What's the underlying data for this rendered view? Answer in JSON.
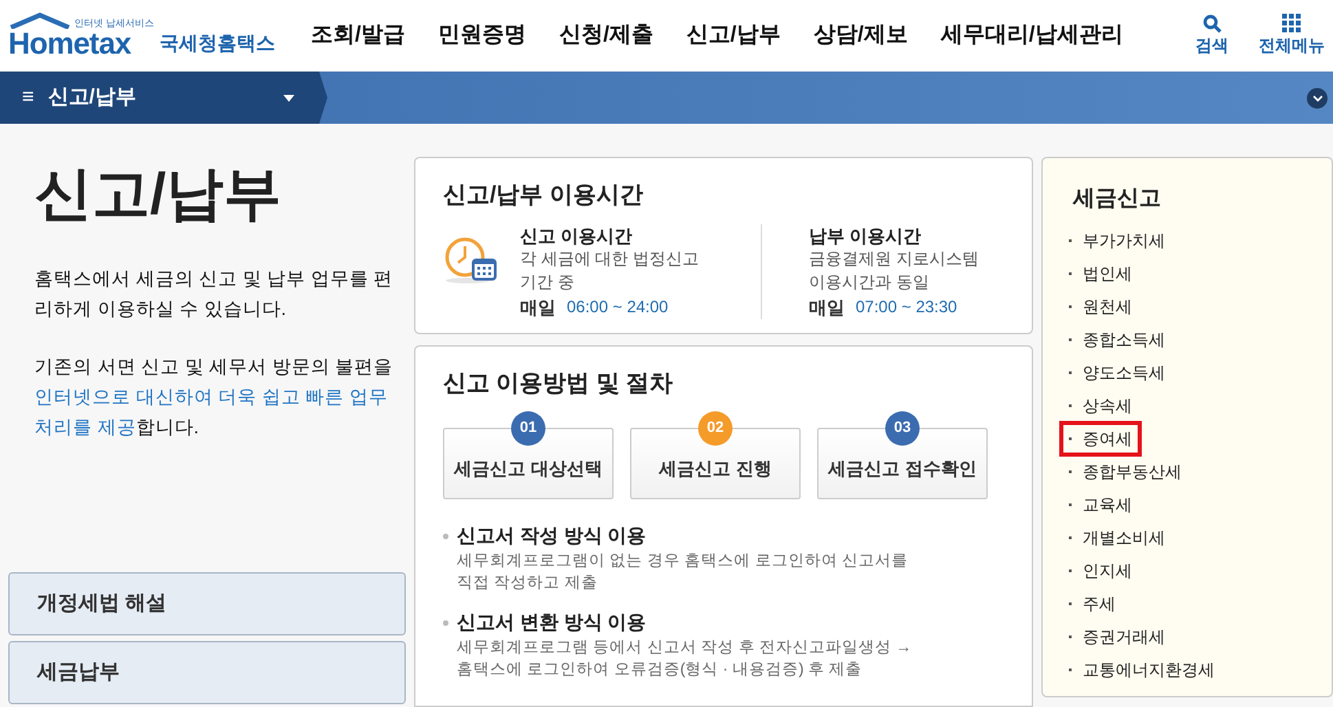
{
  "header": {
    "logo_tagline": "인터넷 납세서비스",
    "logo_text": "Hometax",
    "logo_korean": "국세청홈택스",
    "menu": [
      {
        "label": "조회/발급",
        "selected": false
      },
      {
        "label": "민원증명",
        "selected": false
      },
      {
        "label": "신청/제출",
        "selected": false
      },
      {
        "label": "신고/납부",
        "selected": false
      },
      {
        "label": "상담/제보",
        "selected": false
      },
      {
        "label": "세무대리/납세관리",
        "selected": false
      }
    ],
    "search_label": "검색",
    "all_menu_label": "전체메뉴"
  },
  "breadcrumb": {
    "menu_glyph": "≡",
    "label": "신고/납부"
  },
  "intro": {
    "title": "신고/납부",
    "paragraph_1": "홈택스에서 세금의 신고 및 납부 업무를 편리하게 이용하실 수 있습니다.",
    "paragraph_2_start": "기존의 서면 신고 및 세무서 방문의 불편을",
    "paragraph_2_link": "인터넷으로 대신하여 더욱 쉽고 빠른 업무처리를 제공",
    "paragraph_2_end": "합니다.",
    "links": [
      "개정세법 해설",
      "세금납부"
    ]
  },
  "hours": {
    "title": "신고/납부 이용시간",
    "columns": [
      {
        "title": "신고 이용시간",
        "desc": "각 세금에 대한 법정신고 기간 중",
        "day": "매일",
        "time": "06:00 ~ 24:00"
      },
      {
        "title": "납부 이용시간",
        "desc": "금융결제원 지로시스템 이용시간과 동일",
        "day": "매일",
        "time": "07:00 ~ 23:30"
      }
    ]
  },
  "procedure": {
    "title": "신고 이용방법 및 절차",
    "steps": [
      {
        "number": "01",
        "label": "세금신고 대상선택",
        "color": "#3b6cb0"
      },
      {
        "number": "02",
        "label": "세금신고 진행",
        "color": "#f49b2a"
      },
      {
        "number": "03",
        "label": "세금신고 접수확인",
        "color": "#3b6cb0"
      }
    ],
    "methods": [
      {
        "title": "신고서 작성 방식 이용",
        "desc": "세무회계프로그램이 없는 경우 홈택스에 로그인하여 신고서를 직접 작성하고 제출"
      },
      {
        "title": "신고서 변환 방식 이용",
        "desc": "세무회계프로그램 등에서 신고서 작성 후 전자신고파일생성 → 홈택스에 로그인하여 오류검증(형식 · 내용검증) 후 제출"
      }
    ]
  },
  "tax_filing": {
    "title": "세금신고",
    "items": [
      {
        "label": "부가가치세",
        "highlighted": false
      },
      {
        "label": "법인세",
        "highlighted": false
      },
      {
        "label": "원천세",
        "highlighted": false
      },
      {
        "label": "종합소득세",
        "highlighted": false
      },
      {
        "label": "양도소득세",
        "highlighted": false
      },
      {
        "label": "상속세",
        "highlighted": false
      },
      {
        "label": "증여세",
        "highlighted": true
      },
      {
        "label": "종합부동산세",
        "highlighted": false
      },
      {
        "label": "교육세",
        "highlighted": false
      },
      {
        "label": "개별소비세",
        "highlighted": false
      },
      {
        "label": "인지세",
        "highlighted": false
      },
      {
        "label": "주세",
        "highlighted": false
      },
      {
        "label": "증권거래세",
        "highlighted": false
      },
      {
        "label": "교통에너지환경세",
        "highlighted": false
      }
    ]
  }
}
